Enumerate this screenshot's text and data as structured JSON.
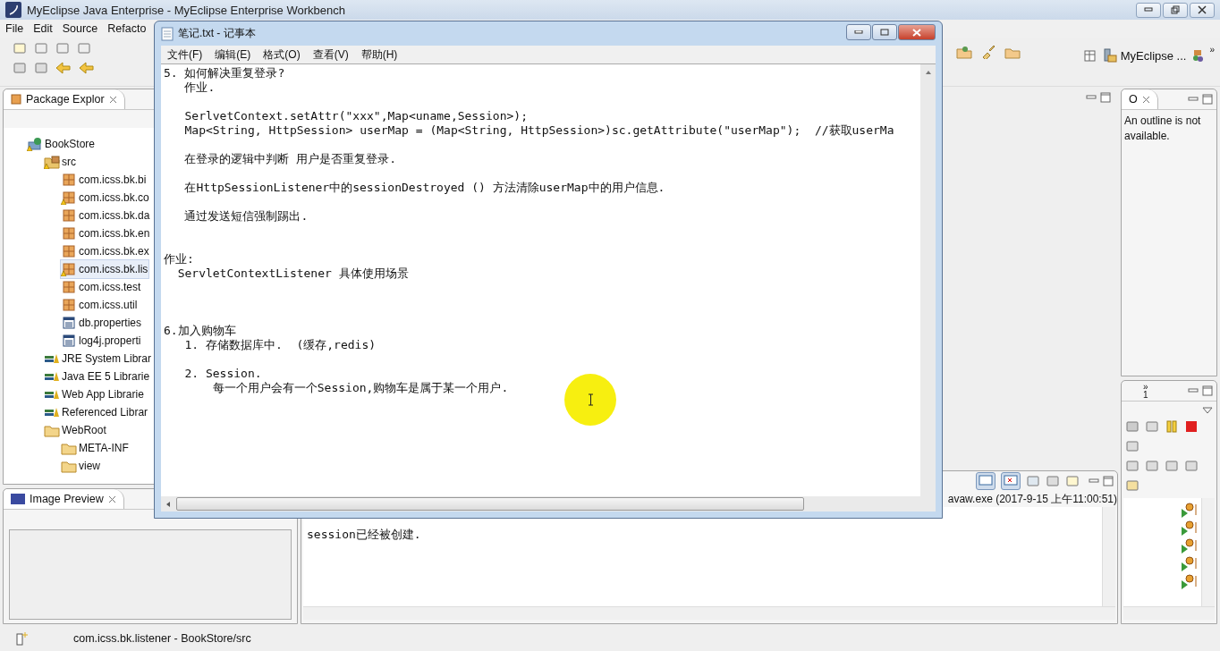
{
  "window": {
    "title": "MyEclipse Java Enterprise - MyEclipse Enterprise Workbench"
  },
  "menu_bar": [
    "File",
    "Edit",
    "Source",
    "Refacto"
  ],
  "perspective": {
    "label": "MyEclipse ...",
    "overflow": "»"
  },
  "package_explorer": {
    "tab": "Package Explor",
    "tree": [
      {
        "label": "BookStore",
        "kind": "project",
        "selected": false,
        "warning": true,
        "children": [
          {
            "label": "src",
            "kind": "source-folder",
            "selected": false,
            "warning": true,
            "children": [
              {
                "label": "com.icss.bk.bi",
                "kind": "package",
                "selected": false,
                "warning": false
              },
              {
                "label": "com.icss.bk.co",
                "kind": "package",
                "selected": false,
                "warning": true
              },
              {
                "label": "com.icss.bk.da",
                "kind": "package",
                "selected": false,
                "warning": false
              },
              {
                "label": "com.icss.bk.en",
                "kind": "package",
                "selected": false,
                "warning": false
              },
              {
                "label": "com.icss.bk.ex",
                "kind": "package",
                "selected": false,
                "warning": false
              },
              {
                "label": "com.icss.bk.lis",
                "kind": "package",
                "selected": true,
                "warning": true
              },
              {
                "label": "com.icss.test",
                "kind": "package",
                "selected": false,
                "warning": false
              },
              {
                "label": "com.icss.util",
                "kind": "package",
                "selected": false,
                "warning": false
              },
              {
                "label": "db.properties",
                "kind": "file",
                "selected": false,
                "warning": false
              },
              {
                "label": "log4j.properti",
                "kind": "file",
                "selected": false,
                "warning": false
              }
            ]
          },
          {
            "label": "JRE System Librar",
            "kind": "library",
            "selected": false,
            "warning": false
          },
          {
            "label": "Java EE 5 Librarie",
            "kind": "library",
            "selected": false,
            "warning": false
          },
          {
            "label": "Web App Librarie",
            "kind": "library",
            "selected": false,
            "warning": false
          },
          {
            "label": "Referenced Librar",
            "kind": "library",
            "selected": false,
            "warning": false
          },
          {
            "label": "WebRoot",
            "kind": "folder",
            "selected": false,
            "warning": false,
            "children": [
              {
                "label": "META-INF",
                "kind": "folder",
                "selected": false,
                "warning": false
              },
              {
                "label": "view",
                "kind": "folder",
                "selected": false,
                "warning": false
              }
            ]
          }
        ]
      }
    ]
  },
  "image_preview": {
    "tab": "Image Preview"
  },
  "outline": {
    "tab": "O",
    "message": "An outline is not available."
  },
  "console": {
    "process": "avaw.exe (2017-9-15 上午11:00:51)",
    "output": "session已经被创建."
  },
  "debug": {
    "chevron": "»",
    "count": "1"
  },
  "status_bar": {
    "text": "com.icss.bk.listener - BookStore/src"
  },
  "notepad": {
    "title": "笔记.txt - 记事本",
    "menus": [
      "文件(F)",
      "编辑(E)",
      "格式(O)",
      "查看(V)",
      "帮助(H)"
    ],
    "text": "5. 如何解决重复登录?\n   作业.\n\n   SerlvetContext.setAttr(\"xxx\",Map<uname,Session>);\n   Map<String, HttpSession> userMap = (Map<String, HttpSession>)sc.getAttribute(\"userMap\");  //获取userMa\n\n   在登录的逻辑中判断 用户是否重复登录.\n\n   在HttpSessionListener中的sessionDestroyed () 方法清除userMap中的用户信息.\n\n   通过发送短信强制踢出.\n\n\n作业:\n  ServletContextListener 具体使用场景\n\n\n\n6.加入购物车\n   1. 存储数据库中.  (缓存,redis)\n\n   2. Session.\n       每一个用户会有一个Session,购物车是属于某一个用户."
  }
}
